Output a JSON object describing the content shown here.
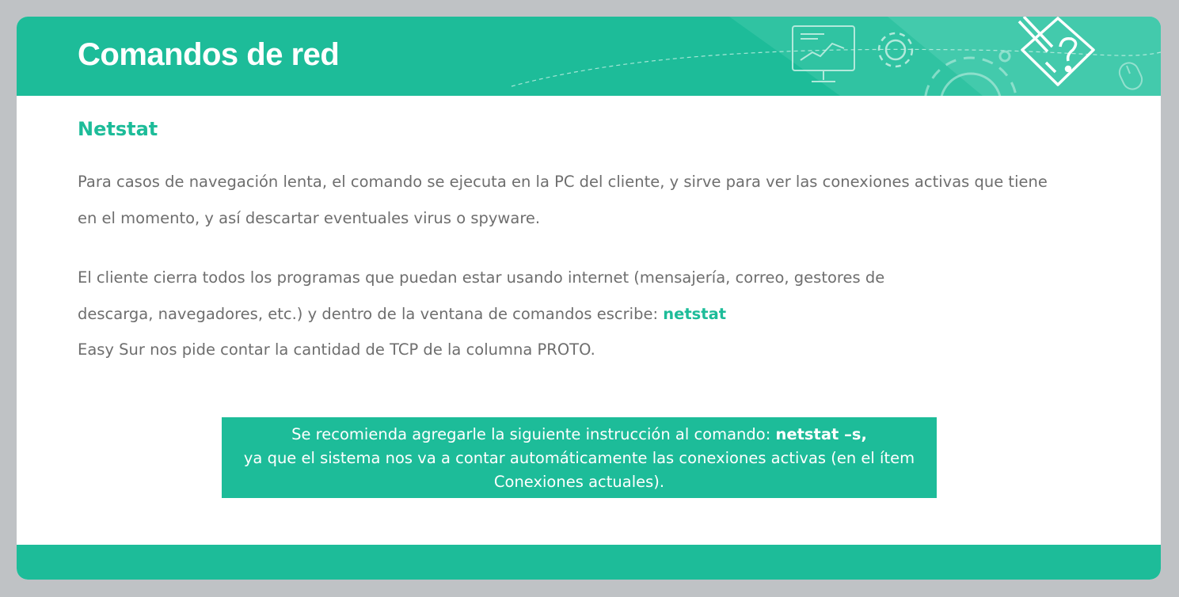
{
  "header": {
    "title": "Comandos de red",
    "accent_color": "#1dbc99"
  },
  "section": {
    "title": "Netstat"
  },
  "paragraph1": {
    "line1": "Para casos de navegación lenta, el comando se ejecuta en la PC del cliente, y sirve para ver las conexiones activas que tiene",
    "line2": "en el momento, y así descartar eventuales virus o spyware."
  },
  "paragraph2": {
    "line1": "El cliente cierra todos los programas que puedan estar usando internet (mensajería, correo, gestores de",
    "line2_text": "descarga, navegadores, etc.) y dentro de la ventana de comandos escribe: ",
    "line2_command": "netstat"
  },
  "paragraph3": {
    "text": "Easy Sur nos pide contar la cantidad de TCP de la columna PROTO."
  },
  "callout": {
    "line1_text": "Se recomienda agregarle la siguiente instrucción al comando: ",
    "line1_command": "netstat –s,",
    "line2": "ya que el sistema nos va a contar automáticamente las conexiones activas (en el ítem",
    "line3": "Conexiones actuales)."
  },
  "icons": [
    "monitor-chart-icon",
    "gear-icon",
    "large-gear-icon",
    "mouse-icon",
    "pencil-question-icon"
  ]
}
